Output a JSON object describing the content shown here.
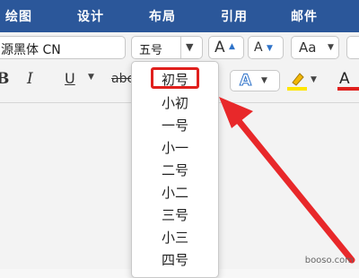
{
  "ribbon": {
    "tabs": [
      "绘图",
      "设计",
      "布局",
      "引用",
      "邮件"
    ]
  },
  "font": {
    "name": "源黑体 CN",
    "size": "五号"
  },
  "toolbar": {
    "grow_label": "A",
    "shrink_label": "A",
    "case_label": "Aa",
    "bold_label": "B",
    "italic_label": "I",
    "underline_label": "U",
    "strike_label": "abc",
    "effects_label": "A",
    "font_color_label": "A"
  },
  "size_dropdown": {
    "items": [
      "初号",
      "小初",
      "一号",
      "小一",
      "二号",
      "小二",
      "三号",
      "小三",
      "四号"
    ],
    "selected": "初号"
  },
  "colors": {
    "ribbon": "#2b579a",
    "highlight": "#e0201d",
    "highlight_yellow": "#ffe600"
  },
  "watermark": "booso.com"
}
